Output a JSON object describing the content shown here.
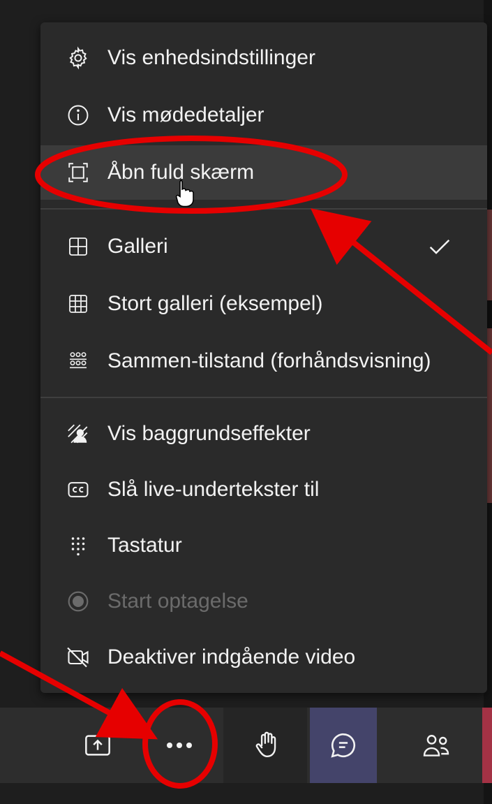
{
  "menu": {
    "items": [
      {
        "label": "Vis enhedsindstillinger",
        "icon": "gear-icon"
      },
      {
        "label": "Vis mødedetaljer",
        "icon": "info-icon"
      },
      {
        "label": "Åbn fuld skærm",
        "icon": "fullscreen-icon",
        "highlighted": true
      },
      {
        "label": "Galleri",
        "icon": "gallery-icon",
        "checked": true
      },
      {
        "label": "Stort galleri (eksempel)",
        "icon": "large-gallery-icon"
      },
      {
        "label": "Sammen-tilstand (forhåndsvisning)",
        "icon": "together-mode-icon"
      },
      {
        "label": "Vis baggrundseffekter",
        "icon": "background-effects-icon"
      },
      {
        "label": "Slå live-undertekster til",
        "icon": "captions-icon"
      },
      {
        "label": "Tastatur",
        "icon": "dialpad-icon"
      },
      {
        "label": "Start optagelse",
        "icon": "record-icon",
        "disabled": true
      },
      {
        "label": "Deaktiver indgående video",
        "icon": "video-off-icon"
      }
    ]
  },
  "toolbar": {
    "buttons": [
      {
        "icon": "share-tray-icon"
      },
      {
        "icon": "more-actions-icon"
      },
      {
        "icon": "raise-hand-icon"
      },
      {
        "icon": "chat-icon",
        "active": true
      },
      {
        "icon": "people-icon"
      }
    ]
  },
  "colors": {
    "menu_bg": "#2a2a2a",
    "highlight_bg": "#3b3b3b",
    "annotation_red": "#e60000",
    "chat_active_bg": "#44446a"
  }
}
